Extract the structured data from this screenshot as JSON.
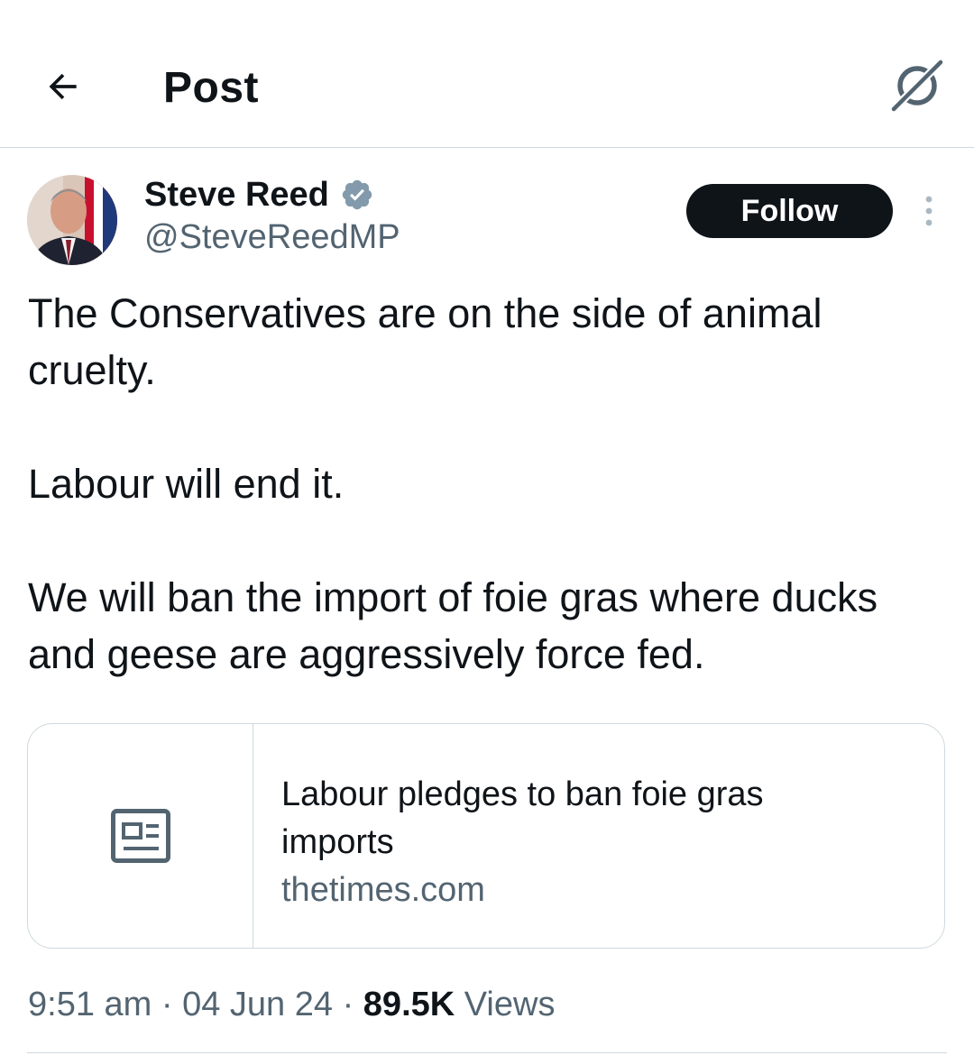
{
  "header": {
    "title": "Post",
    "back_icon": "arrow-left-icon",
    "grok_icon": "grok-icon"
  },
  "author": {
    "display_name": "Steve Reed",
    "handle": "@SteveReedMP",
    "verified": true,
    "verified_color": "#829aab",
    "follow_label": "Follow",
    "more_icon": "more-vertical-icon"
  },
  "tweet": {
    "text": "The Conservatives are on the side of animal cruelty.\n\nLabour will end it.\n\nWe will ban the import of foie gras where ducks and geese are aggressively force fed."
  },
  "link_card": {
    "icon": "news-article-icon",
    "title": "Labour pledges to ban foie gras imports",
    "domain": "thetimes.com"
  },
  "meta": {
    "time": "9:51 am",
    "separator": "·",
    "date": "04 Jun 24",
    "views_count": "89.5K",
    "views_label": "Views"
  },
  "colors": {
    "text_primary": "#0f1419",
    "text_secondary": "#536471",
    "border": "#cfd9de",
    "follow_bg": "#0f1419"
  }
}
